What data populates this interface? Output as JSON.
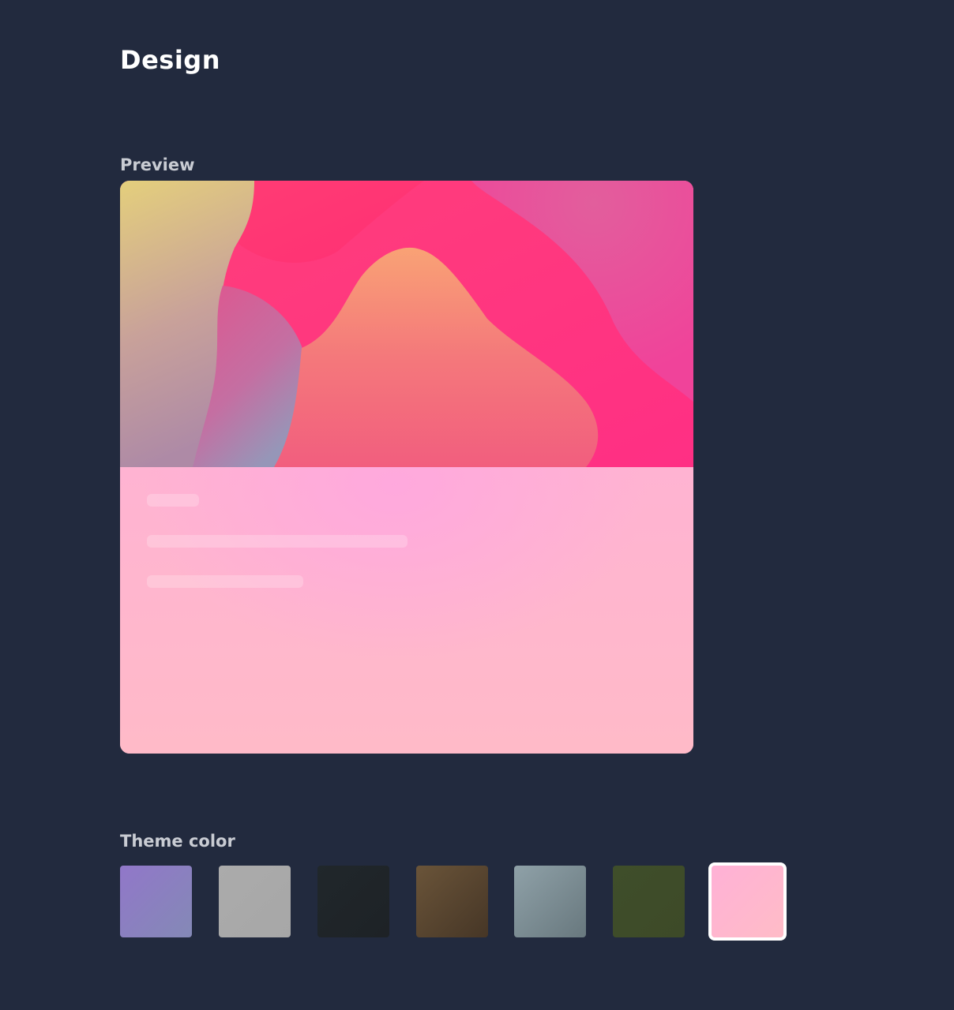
{
  "page": {
    "title": "Design"
  },
  "preview": {
    "label": "Preview"
  },
  "theme": {
    "label": "Theme color",
    "selected_index": 6,
    "swatches": [
      {
        "name": "purple",
        "color_from": "#9177c9",
        "color_to": "#8489b6"
      },
      {
        "name": "gray",
        "color_from": "#ababab",
        "color_to": "#a7a7a7"
      },
      {
        "name": "charcoal",
        "color_from": "#20272b",
        "color_to": "#1e2226"
      },
      {
        "name": "brown",
        "color_from": "#6a5439",
        "color_to": "#463626"
      },
      {
        "name": "slate",
        "color_from": "#8fa1a8",
        "color_to": "#68787e"
      },
      {
        "name": "olive",
        "color_from": "#3f4e2a",
        "color_to": "#3d4a28"
      },
      {
        "name": "pink",
        "color_from": "#ffb1d6",
        "color_to": "#ffbcc7"
      }
    ]
  }
}
